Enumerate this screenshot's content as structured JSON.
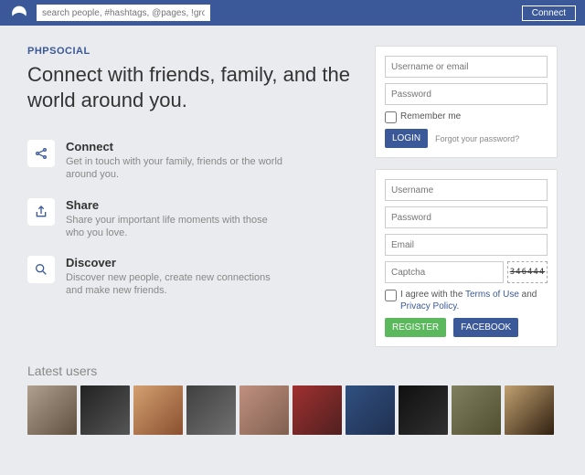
{
  "topbar": {
    "search_placeholder": "search people, #hashtags, @pages, !groups",
    "connect_label": "Connect"
  },
  "hero": {
    "brand": "PHPSOCIAL",
    "tagline": "Connect with friends, family, and the world around you."
  },
  "features": [
    {
      "title": "Connect",
      "desc": "Get in touch with your family, friends or the world around you."
    },
    {
      "title": "Share",
      "desc": "Share your important life moments with those who you love."
    },
    {
      "title": "Discover",
      "desc": "Discover new people, create new connections and make new friends."
    }
  ],
  "login": {
    "user_placeholder": "Username or email",
    "pass_placeholder": "Password",
    "remember_label": "Remember me",
    "login_btn": "LOGIN",
    "forgot_label": "Forgot your password?"
  },
  "register": {
    "user_placeholder": "Username",
    "pass_placeholder": "Password",
    "email_placeholder": "Email",
    "captcha_placeholder": "Captcha",
    "captcha_value": "346444",
    "agree_prefix": "I agree with the ",
    "terms_label": "Terms of Use",
    "agree_mid": " and ",
    "privacy_label": "Privacy Policy",
    "agree_suffix": ".",
    "register_btn": "REGISTER",
    "facebook_btn": "FACEBOOK"
  },
  "latest": {
    "title": "Latest users"
  }
}
